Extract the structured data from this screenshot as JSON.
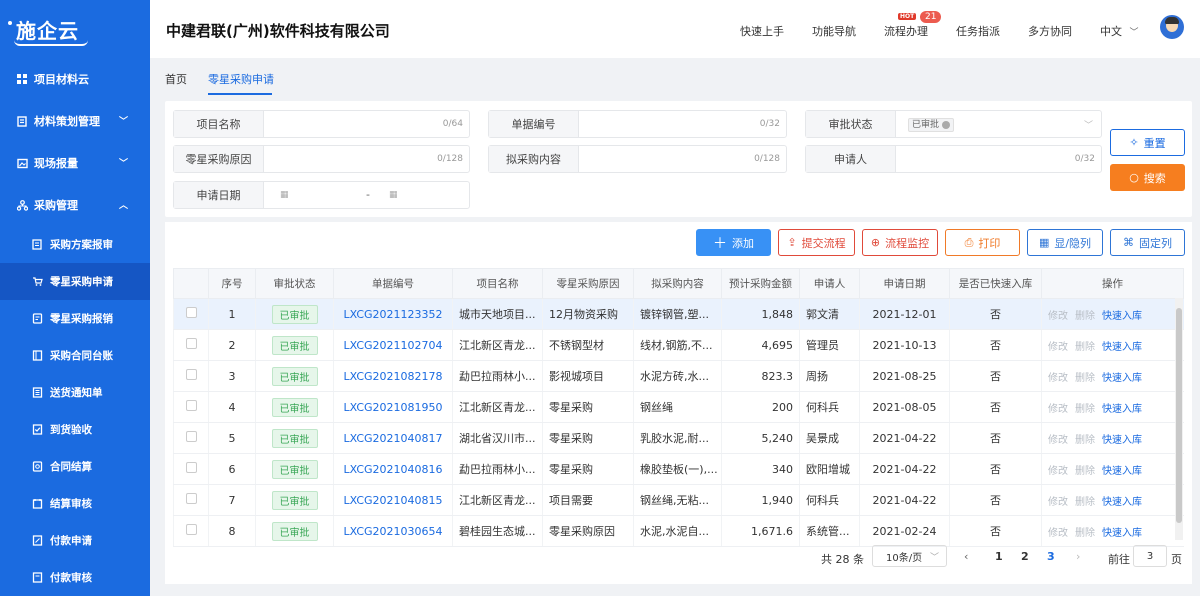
{
  "brand": {
    "logo": "施企云",
    "company": "中建君联(广州)软件科技有限公司"
  },
  "header": {
    "nav": [
      "快速上手",
      "功能导航",
      "流程办理",
      "任务指派",
      "多方协同"
    ],
    "hot_tag": "HOT",
    "flow_badge": "21",
    "language": "中文"
  },
  "sidebar": {
    "items": [
      {
        "label": "项目材料云",
        "icon": "grid-icon"
      },
      {
        "label": "材料策划管理",
        "icon": "book-icon"
      },
      {
        "label": "现场报量",
        "icon": "image-icon"
      },
      {
        "label": "采购管理",
        "icon": "org-icon"
      }
    ],
    "sub_items": [
      "采购方案报审",
      "零星采购申请",
      "零星采购报销",
      "采购合同台账",
      "送货通知单",
      "到货验收",
      "合同结算",
      "结算审核",
      "付款申请",
      "付款审核"
    ],
    "active_sub": "零星采购申请"
  },
  "tabs": [
    "首页",
    "零星采购申请"
  ],
  "filters": {
    "project_name": {
      "label": "项目名称",
      "count": "0/64"
    },
    "doc_no": {
      "label": "单据编号",
      "count": "0/32"
    },
    "approval_status": {
      "label": "审批状态",
      "value": "已审批"
    },
    "reason": {
      "label": "零星采购原因",
      "count": "0/128"
    },
    "content": {
      "label": "拟采购内容",
      "count": "0/128"
    },
    "applicant": {
      "label": "申请人",
      "count": "0/32"
    },
    "date": {
      "label": "申请日期",
      "sep": "-"
    }
  },
  "buttons": {
    "reset": "重置",
    "search": "搜索"
  },
  "toolbar": {
    "add": "添加",
    "submit": "提交流程",
    "monitor": "流程监控",
    "print": "打印",
    "toggle_cols": "显/隐列",
    "pin_cols": "固定列"
  },
  "table": {
    "columns": [
      "序号",
      "审批状态",
      "单据编号",
      "项目名称",
      "零星采购原因",
      "拟采购内容",
      "预计采购金额",
      "申请人",
      "申请日期",
      "是否已快速入库",
      "操作"
    ],
    "rows": [
      {
        "no": "1",
        "status": "已审批",
        "code": "LXCG2021123352",
        "project": "城市天地项目...",
        "reason": "12月物资采购",
        "content": "镀锌钢管,塑...",
        "amount": "1,848",
        "applicant": "郭文清",
        "date": "2021-12-01",
        "stocked": "否"
      },
      {
        "no": "2",
        "status": "已审批",
        "code": "LXCG2021102704",
        "project": "江北新区青龙...",
        "reason": "不锈钢型材",
        "content": "线材,钢筋,不...",
        "amount": "4,695",
        "applicant": "管理员",
        "date": "2021-10-13",
        "stocked": "否"
      },
      {
        "no": "3",
        "status": "已审批",
        "code": "LXCG2021082178",
        "project": "勐巴拉雨林小...",
        "reason": "影视城项目",
        "content": "水泥方砖,水...",
        "amount": "823.3",
        "applicant": "周扬",
        "date": "2021-08-25",
        "stocked": "否"
      },
      {
        "no": "4",
        "status": "已审批",
        "code": "LXCG2021081950",
        "project": "江北新区青龙...",
        "reason": "零星采购",
        "content": "钢丝绳",
        "amount": "200",
        "applicant": "何科兵",
        "date": "2021-08-05",
        "stocked": "否"
      },
      {
        "no": "5",
        "status": "已审批",
        "code": "LXCG2021040817",
        "project": "湖北省汉川市...",
        "reason": "零星采购",
        "content": "乳胶水泥,耐...",
        "amount": "5,240",
        "applicant": "吴景成",
        "date": "2021-04-22",
        "stocked": "否"
      },
      {
        "no": "6",
        "status": "已审批",
        "code": "LXCG2021040816",
        "project": "勐巴拉雨林小...",
        "reason": "零星采购",
        "content": "橡胶垫板(一),...",
        "amount": "340",
        "applicant": "欧阳增城",
        "date": "2021-04-22",
        "stocked": "否"
      },
      {
        "no": "7",
        "status": "已审批",
        "code": "LXCG2021040815",
        "project": "江北新区青龙...",
        "reason": "项目需要",
        "content": "钢丝绳,无粘...",
        "amount": "1,940",
        "applicant": "何科兵",
        "date": "2021-04-22",
        "stocked": "否"
      },
      {
        "no": "8",
        "status": "已审批",
        "code": "LXCG2021030654",
        "project": "碧桂园生态城...",
        "reason": "零星采购原因",
        "content": "水泥,水泥自...",
        "amount": "1,671.6",
        "applicant": "系统管...",
        "date": "2021-02-24",
        "stocked": "否"
      }
    ],
    "ops": {
      "edit": "修改",
      "delete": "删除",
      "quick_stock": "快速入库"
    }
  },
  "pagination": {
    "total": "共 28 条",
    "page_size": "10条/页",
    "pages": [
      "1",
      "2",
      "3"
    ],
    "current": "3",
    "goto_label": "前往",
    "goto_value": "3",
    "goto_suffix": "页"
  },
  "colors": {
    "primary": "#1b6be0",
    "accent_orange": "#f67e1f",
    "danger": "#e04a3a",
    "success": "#3aa757"
  }
}
